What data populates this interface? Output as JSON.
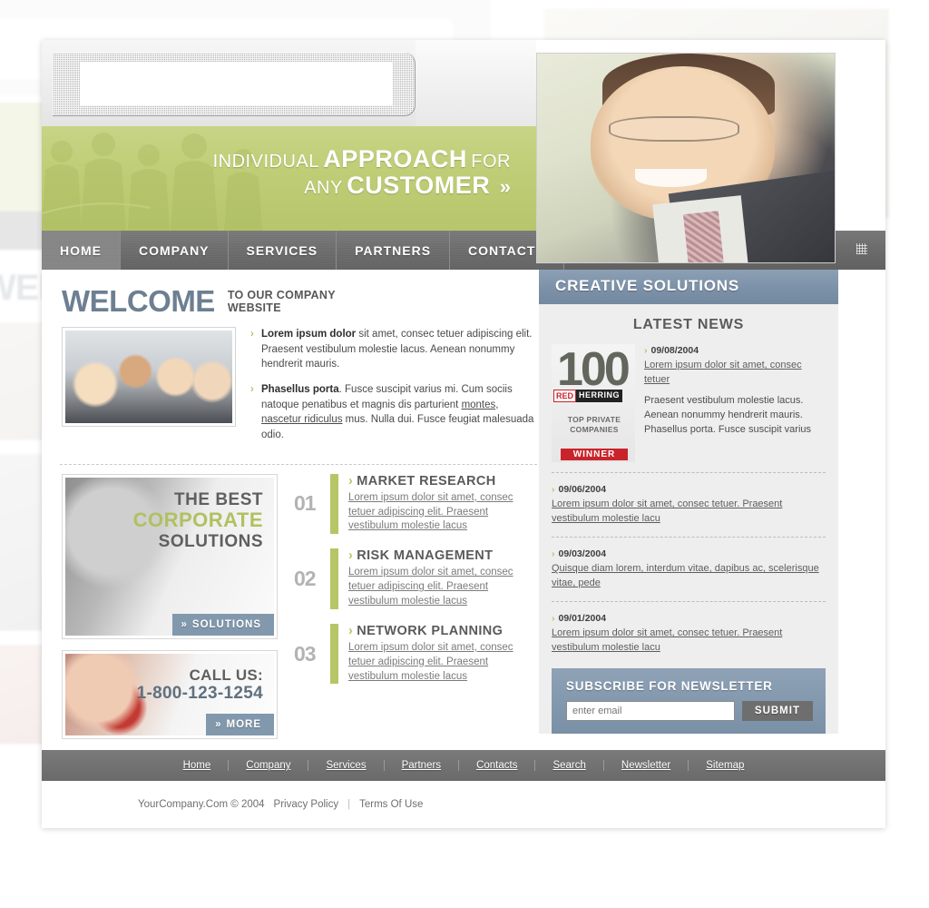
{
  "header": {
    "logo_placeholder": "",
    "tagline": {
      "line1_thin": "INDIVIDUAL",
      "line1_bold": "APPROACH",
      "line1_tail": "FOR",
      "line2_thin": "ANY",
      "line2_bold": "CUSTOMER",
      "arrow": "»"
    }
  },
  "nav": {
    "items": [
      {
        "label": "HOME",
        "active": true
      },
      {
        "label": "COMPANY",
        "active": false
      },
      {
        "label": "SERVICES",
        "active": false
      },
      {
        "label": "PARTNERS",
        "active": false
      },
      {
        "label": "CONTACTS",
        "active": false
      }
    ]
  },
  "welcome": {
    "title": "WELCOME",
    "subtitle_line1": "TO OUR COMPANY",
    "subtitle_line2": "WEBSITE",
    "paragraphs": [
      {
        "lead": "Lorem ipsum dolor",
        "body": " sit amet, consec tetuer adipiscing elit. Praesent vestibulum molestie lacus. Aenean nonummy hendrerit mauris."
      },
      {
        "lead": "Phasellus porta",
        "body_a": ". Fusce suscipit varius mi. Cum sociis natoque penatibus et magnis dis parturient ",
        "link": "montes, nascetur ridiculus",
        "body_b": " mus. Nulla dui. Fusce feugiat malesuada odio."
      }
    ]
  },
  "promos": [
    {
      "line1": "THE BEST",
      "line2": "CORPORATE",
      "line3": "SOLUTIONS",
      "button": "SOLUTIONS",
      "arrow": "»"
    },
    {
      "label": "CALL US:",
      "phone": "1-800-123-1254",
      "button": "MORE",
      "arrow": "»"
    }
  ],
  "services": [
    {
      "number": "01",
      "title": "MARKET RESEARCH",
      "desc": "Lorem ipsum dolor sit amet, consec tetuer adipiscing elit. Praesent vestibulum molestie lacus",
      "arrow": "›"
    },
    {
      "number": "02",
      "title": "RISK MANAGEMENT",
      "desc": "Lorem ipsum dolor sit amet, consec tetuer adipiscing elit. Praesent vestibulum molestie lacus",
      "arrow": "›"
    },
    {
      "number": "03",
      "title": "NETWORK PLANNING",
      "desc": "Lorem ipsum dolor sit amet, consec tetuer adipiscing elit. Praesent vestibulum molestie lacus",
      "arrow": "›"
    }
  ],
  "sidebar": {
    "creative_solutions_title": "CREATIVE SOLUTIONS",
    "latest_news_title": "LATEST NEWS",
    "award_badge": {
      "number": "100",
      "brand_red": "RED",
      "brand_black": "HERRING",
      "caption_line1": "TOP PRIVATE",
      "caption_line2": "COMPANIES",
      "winner": "WINNER"
    },
    "news": [
      {
        "date": "09/08/2004",
        "link": "Lorem ipsum dolor sit amet, consec tetuer",
        "body": "Praesent vestibulum molestie lacus. Aenean nonummy hendrerit mauris. Phasellus porta. Fusce suscipit varius",
        "arrow": "›"
      },
      {
        "date": "09/06/2004",
        "link": "Lorem ipsum dolor sit amet, consec tetuer. Praesent vestibulum molestie lacu",
        "arrow": "›"
      },
      {
        "date": "09/03/2004",
        "link": "Quisque diam lorem, interdum vitae, dapibus ac, scelerisque vitae, pede",
        "arrow": "›"
      },
      {
        "date": "09/01/2004",
        "link": "Lorem ipsum dolor sit amet, consec tetuer. Praesent vestibulum molestie lacu",
        "arrow": "›"
      }
    ],
    "newsletter": {
      "title": "SUBSCRIBE FOR NEWSLETTER",
      "placeholder": "enter email",
      "value": "",
      "submit": "SUBMIT"
    }
  },
  "footer": {
    "links": [
      "Home",
      "Company",
      "Services",
      "Partners",
      "Contacts",
      "Search",
      "Newsletter",
      "Sitemap"
    ],
    "copyright": "YourCompany.Com © 2004",
    "privacy": "Privacy Policy",
    "terms": "Terms Of Use",
    "divider": "|"
  },
  "colors": {
    "green": "#bfcd76",
    "blue": "#7d92a9",
    "nav_gray": "#6b6b6b",
    "heading_blue": "#6d7f92",
    "accent_olive": "#b6c667"
  }
}
